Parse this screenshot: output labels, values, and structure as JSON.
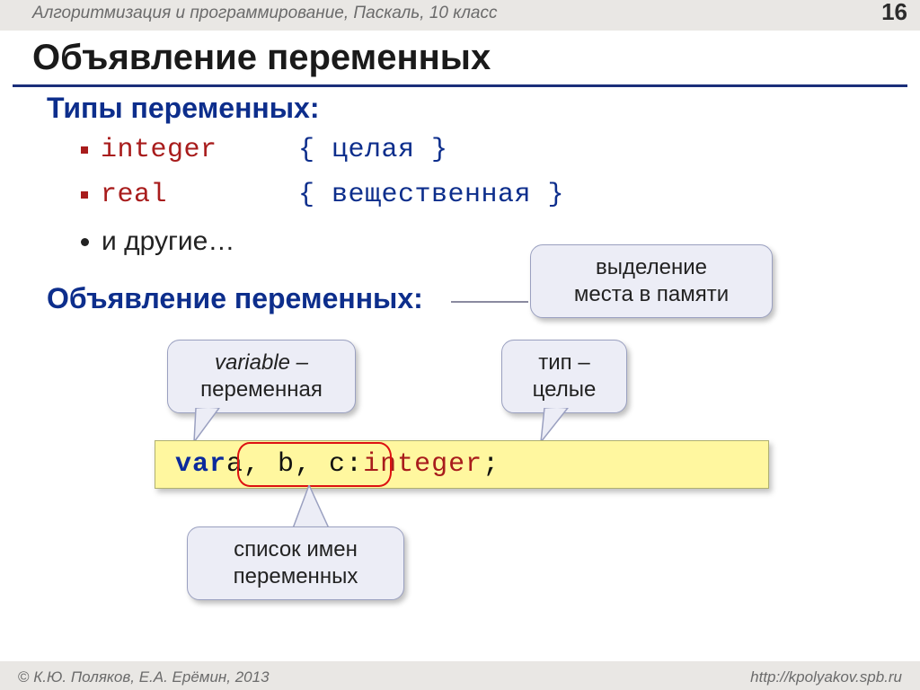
{
  "header": {
    "course": "Алгоритмизация и программирование, Паскаль, 10 класс",
    "page": "16"
  },
  "title": "Объявление переменных",
  "types_heading": "Типы переменных:",
  "types": [
    {
      "keyword": "integer",
      "comment": "{ целая }"
    },
    {
      "keyword": "real",
      "comment": "{ вещественная }"
    }
  ],
  "types_other": "и другие…",
  "decl_heading": "Объявление переменных:",
  "callouts": {
    "memory": {
      "line1": "выделение",
      "line2": "места в памяти"
    },
    "variable": {
      "line1": "variable –",
      "line2": "переменная"
    },
    "type": {
      "line1": "тип –",
      "line2": "целые"
    },
    "names": {
      "line1": "список имен",
      "line2": "переменных"
    }
  },
  "code": {
    "kw": "var",
    "sp1": " ",
    "names": "a, b, c",
    "colon_sp": ": ",
    "type": "integer",
    "semi": ";"
  },
  "footer": {
    "copy": "К.Ю. Поляков, Е.А. Ерёмин, 2013",
    "url": "http://kpolyakov.spb.ru"
  }
}
